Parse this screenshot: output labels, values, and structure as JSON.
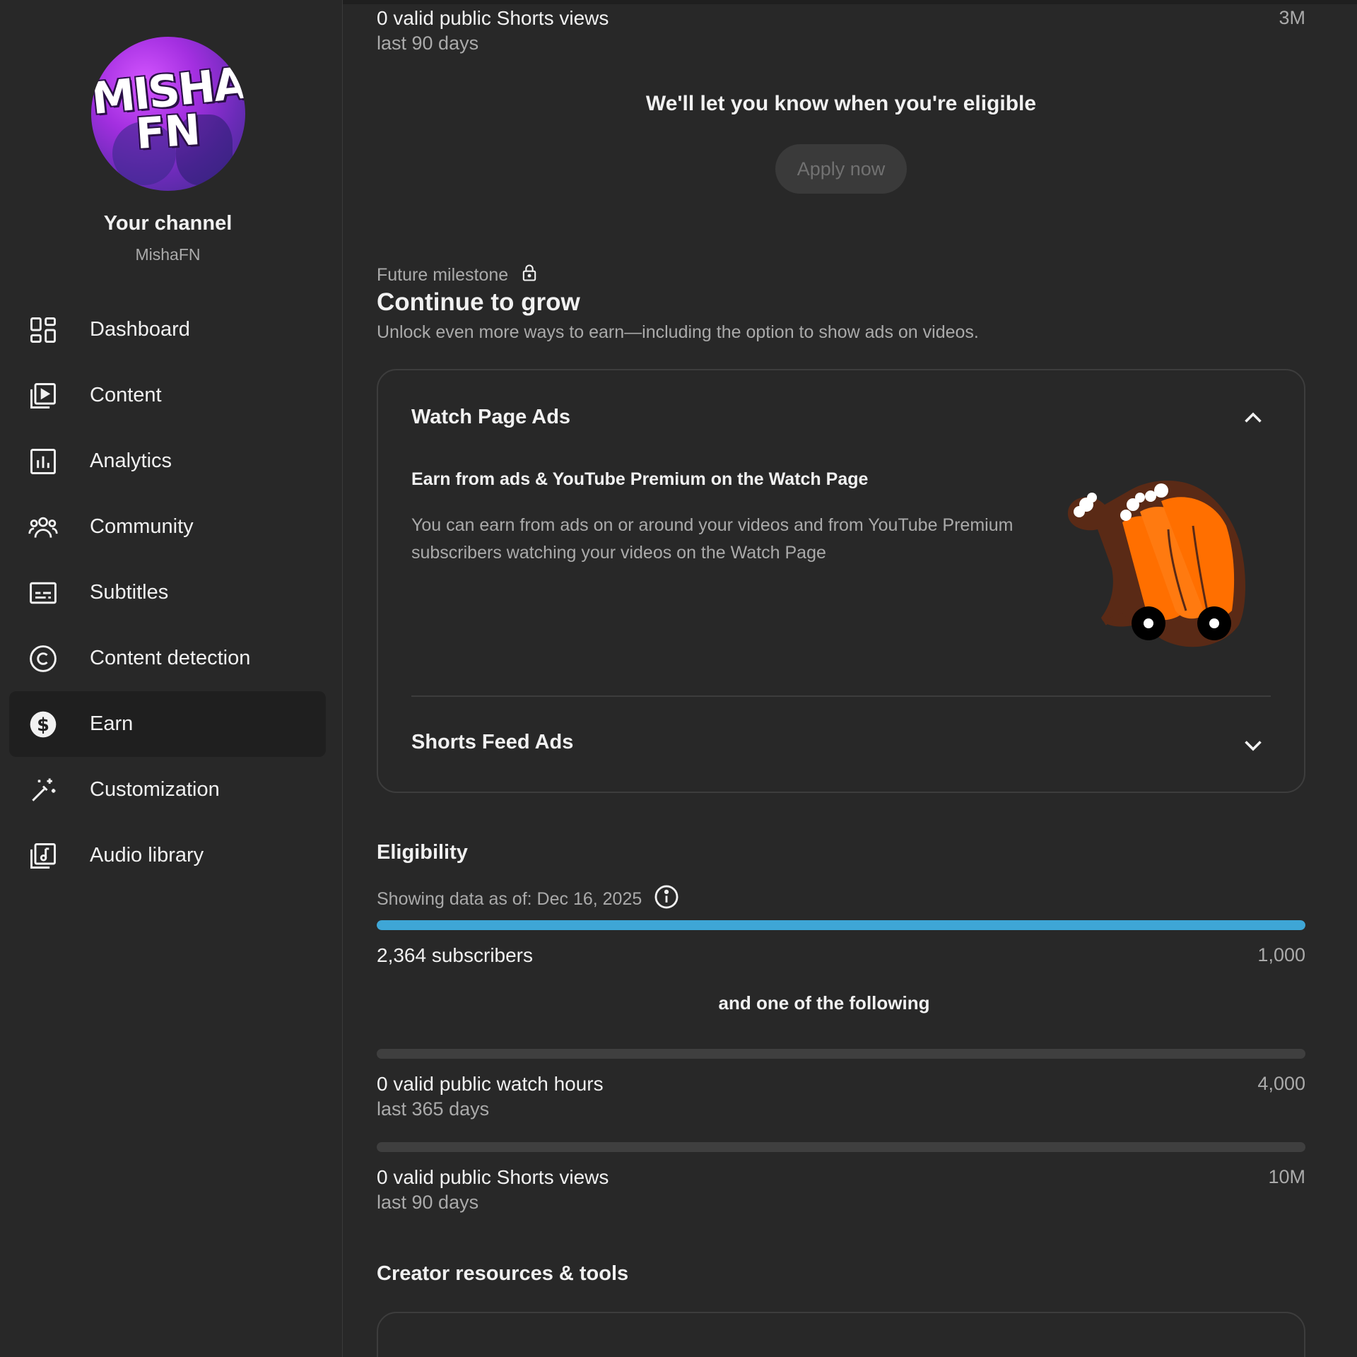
{
  "sidebar": {
    "avatar_logo_line1": "MISHA",
    "avatar_logo_line2": "FN",
    "channel_title": "Your channel",
    "channel_handle": "MishaFN",
    "items": [
      {
        "label": "Dashboard",
        "icon": "dashboard-icon"
      },
      {
        "label": "Content",
        "icon": "content-icon"
      },
      {
        "label": "Analytics",
        "icon": "analytics-icon"
      },
      {
        "label": "Community",
        "icon": "community-icon"
      },
      {
        "label": "Subtitles",
        "icon": "subtitles-icon"
      },
      {
        "label": "Content detection",
        "icon": "copyright-icon"
      },
      {
        "label": "Earn",
        "icon": "dollar-icon",
        "active": true
      },
      {
        "label": "Customization",
        "icon": "magic-wand-icon"
      },
      {
        "label": "Audio library",
        "icon": "audio-library-icon"
      }
    ]
  },
  "top_stat": {
    "label": "0 valid public Shorts views",
    "sub": "last 90 days",
    "target": "3M"
  },
  "eligible_message": "We'll let you know when you're eligible",
  "apply_button": "Apply now",
  "milestone": {
    "eyebrow": "Future milestone",
    "title": "Continue to grow",
    "subtitle": "Unlock even more ways to earn—including the option to show ads on videos."
  },
  "accordion": {
    "watch_page": {
      "title": "Watch Page Ads",
      "expanded": true,
      "heading": "Earn from ads & YouTube Premium on the Watch Page",
      "description": "You can earn from ads on or around your videos and from YouTube Premium subscribers watching your videos on the Watch Page"
    },
    "shorts_feed": {
      "title": "Shorts Feed Ads",
      "expanded": false
    }
  },
  "eligibility": {
    "title": "Eligibility",
    "date_text": "Showing data as of: Dec 16, 2025",
    "subscribers": {
      "label": "2,364 subscribers",
      "target": "1,000",
      "progress": 1.0
    },
    "and_one": "and one of the following",
    "watch_hours": {
      "label": "0 valid public watch hours",
      "sub": "last 365 days",
      "target": "4,000",
      "progress": 0
    },
    "shorts_views": {
      "label": "0 valid public Shorts views",
      "sub": "last 90 days",
      "target": "10M",
      "progress": 0
    }
  },
  "resources_title": "Creator resources & tools",
  "colors": {
    "background": "#282828",
    "progress_fill": "#3ea6d6",
    "illustration_orange": "#ff6f00"
  }
}
